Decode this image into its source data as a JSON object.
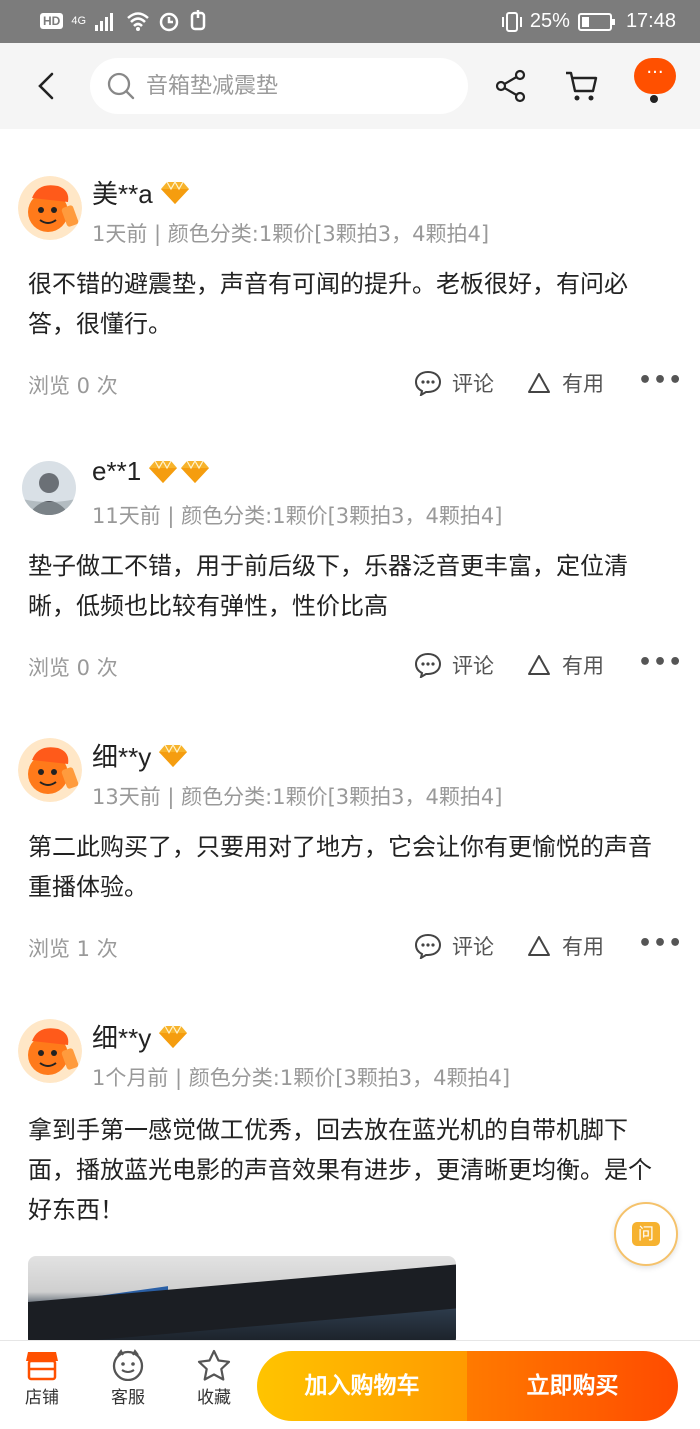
{
  "status_bar": {
    "network": "4G",
    "battery": "25%",
    "time": "17:48"
  },
  "header": {
    "search_placeholder": "音箱垫减震垫",
    "more_label": "···"
  },
  "reviews": [
    {
      "username": "美**a",
      "gems": 1,
      "meta": "1天前 | 颜色分类:1颗价[3颗拍3，4颗拍4]",
      "content": "很不错的避震垫，声音有可闻的提升。老板很好，有问必答，很懂行。",
      "views": "浏览 0 次",
      "comment_label": "评论",
      "useful_label": "有用"
    },
    {
      "username": "e**1",
      "gems": 2,
      "meta": "11天前 | 颜色分类:1颗价[3颗拍3，4颗拍4]",
      "content": "垫子做工不错，用于前后级下，乐器泛音更丰富，定位清晰，低频也比较有弹性，性价比高",
      "views": "浏览 0 次",
      "comment_label": "评论",
      "useful_label": "有用"
    },
    {
      "username": "细**y",
      "gems": 1,
      "meta": "13天前 | 颜色分类:1颗价[3颗拍3，4颗拍4]",
      "content": "第二此购买了，只要用对了地方，它会让你有更愉悦的声音重播体验。",
      "views": "浏览 1 次",
      "comment_label": "评论",
      "useful_label": "有用"
    },
    {
      "username": "细**y",
      "gems": 1,
      "meta": "1个月前 | 颜色分类:1颗价[3颗拍3，4颗拍4]",
      "content": "拿到手第一感觉做工优秀，回去放在蓝光机的自带机脚下面，播放蓝光电影的声音效果有进步，更清晰更均衡。是个好东西！"
    }
  ],
  "ask_button": "问",
  "bottom_bar": {
    "store_label": "店铺",
    "service_label": "客服",
    "favorite_label": "收藏",
    "add_to_cart": "加入购物车",
    "buy_now": "立即购买"
  },
  "colors": {
    "accent": "#ff5000",
    "gem": "#f7b32b",
    "cart_start": "#ffc400",
    "buy_end": "#ff4b00"
  }
}
